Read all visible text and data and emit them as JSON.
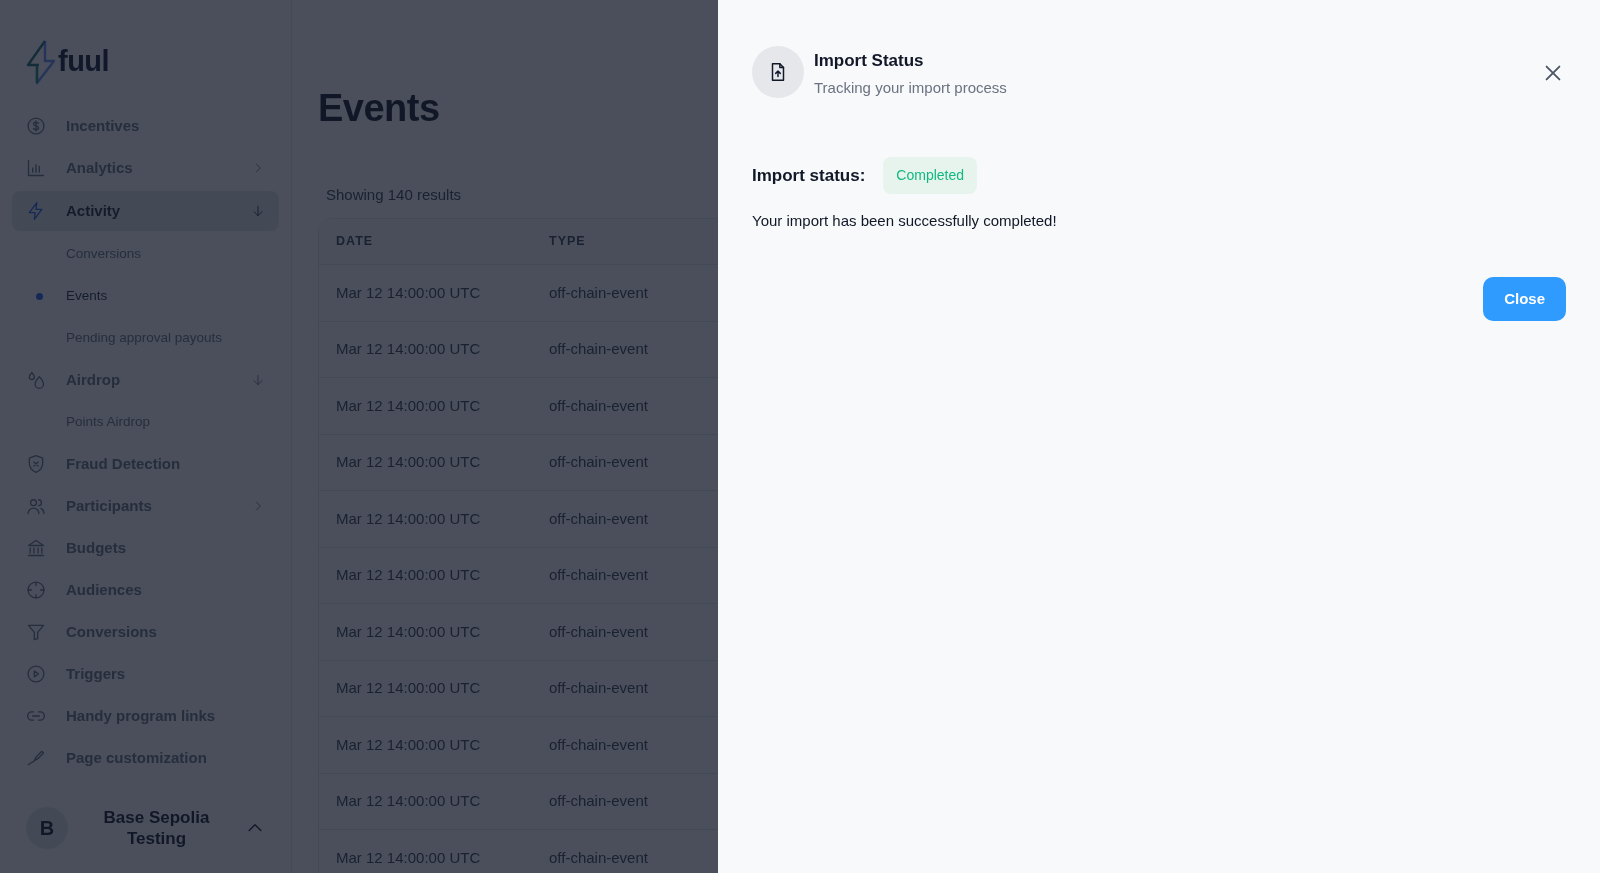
{
  "logo": {
    "text": "fuul"
  },
  "sidebar": {
    "items": [
      {
        "label": "Incentives",
        "kind": "link",
        "selected": false
      },
      {
        "label": "Analytics",
        "kind": "group",
        "expanded": false,
        "selected": false
      },
      {
        "label": "Activity",
        "kind": "group",
        "expanded": true,
        "selected": true,
        "children": [
          {
            "label": "Conversions",
            "selected": false
          },
          {
            "label": "Events",
            "selected": true
          },
          {
            "label": "Pending approval payouts",
            "selected": false
          }
        ]
      },
      {
        "label": "Airdrop",
        "kind": "group",
        "expanded": true,
        "selected": false,
        "children": [
          {
            "label": "Points Airdrop",
            "selected": false
          }
        ]
      },
      {
        "label": "Fraud Detection",
        "kind": "link",
        "selected": false
      },
      {
        "label": "Participants",
        "kind": "group",
        "expanded": false,
        "selected": false
      },
      {
        "label": "Budgets",
        "kind": "link",
        "selected": false
      },
      {
        "label": "Audiences",
        "kind": "link",
        "selected": false
      },
      {
        "label": "Conversions",
        "kind": "link",
        "selected": false
      },
      {
        "label": "Triggers",
        "kind": "link",
        "selected": false
      },
      {
        "label": "Handy program links",
        "kind": "link",
        "selected": false
      },
      {
        "label": "Page customization",
        "kind": "link",
        "selected": false
      }
    ],
    "workspace": {
      "avatar": "B",
      "name": "Base Sepolia Testing"
    }
  },
  "page": {
    "title": "Events",
    "results": "Showing 140 results"
  },
  "table": {
    "columns": [
      "DATE",
      "TYPE"
    ],
    "rows": [
      [
        "Mar 12 14:00:00 UTC",
        "off-chain-event"
      ],
      [
        "Mar 12 14:00:00 UTC",
        "off-chain-event"
      ],
      [
        "Mar 12 14:00:00 UTC",
        "off-chain-event"
      ],
      [
        "Mar 12 14:00:00 UTC",
        "off-chain-event"
      ],
      [
        "Mar 12 14:00:00 UTC",
        "off-chain-event"
      ],
      [
        "Mar 12 14:00:00 UTC",
        "off-chain-event"
      ],
      [
        "Mar 12 14:00:00 UTC",
        "off-chain-event"
      ],
      [
        "Mar 12 14:00:00 UTC",
        "off-chain-event"
      ],
      [
        "Mar 12 14:00:00 UTC",
        "off-chain-event"
      ],
      [
        "Mar 12 14:00:00 UTC",
        "off-chain-event"
      ],
      [
        "Mar 12 14:00:00 UTC",
        "off-chain-event"
      ]
    ]
  },
  "drawer": {
    "title": "Import Status",
    "subtitle": "Tracking your import process",
    "status_label": "Import status:",
    "status": "Completed",
    "message": "Your import has been successfully completed!",
    "button": "Close"
  }
}
